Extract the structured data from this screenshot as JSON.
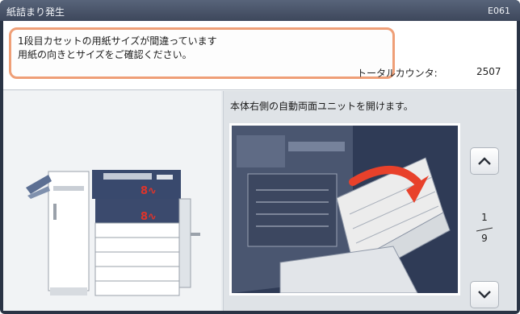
{
  "window": {
    "title": "紙詰まり発生",
    "error_code": "E061"
  },
  "message": {
    "line1": "1段目カセットの用紙サイズが間違っています",
    "line2": "用紙の向きとサイズをご確認ください。"
  },
  "counter": {
    "label": "トータルカウンタ:",
    "value": "2507"
  },
  "guide": {
    "instruction": "本体右側の自動両面ユニットを開けます。",
    "current_page": "1",
    "total_pages": "9"
  },
  "colors": {
    "highlight_border": "#ef9f77",
    "jam_mark": "#e0342a",
    "arrow": "#e8412b"
  },
  "icons": {
    "up": "chevron-up-icon",
    "down": "chevron-down-icon"
  }
}
